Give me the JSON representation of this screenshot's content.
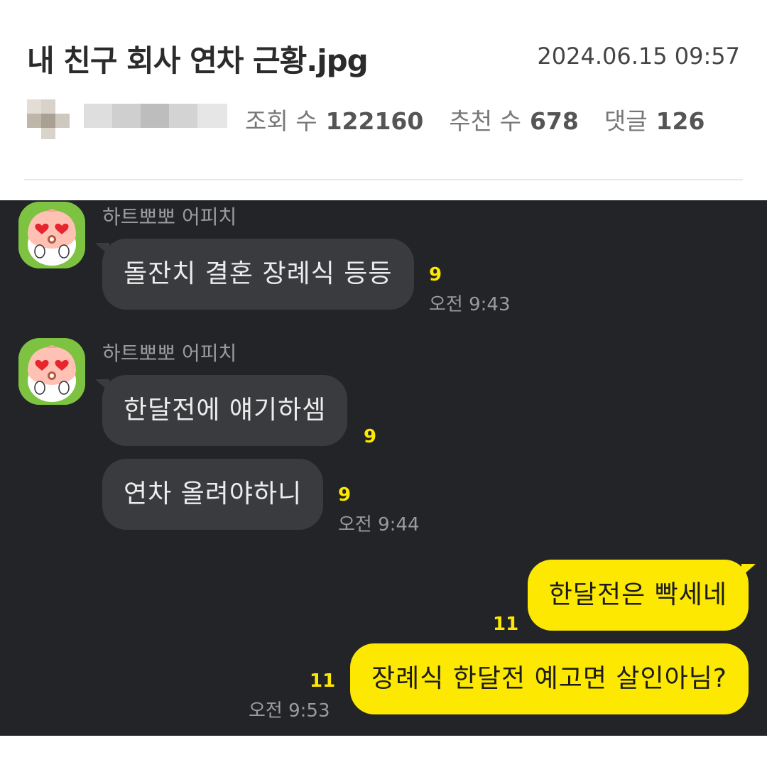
{
  "post": {
    "title": "내 친구 회사 연차 근황.jpg",
    "date": "2024.06.15 09:57",
    "stats": {
      "views_label": "조회 수",
      "views": "122160",
      "likes_label": "추천 수",
      "likes": "678",
      "comments_label": "댓글",
      "comments": "126"
    }
  },
  "chat": {
    "messages": [
      {
        "sender": "하트뽀뽀 어피치",
        "text": "돌잔치 결혼 장례식 등등",
        "unread": "9",
        "time": "오전 9:43"
      },
      {
        "sender": "하트뽀뽀 어피치",
        "text": "한달전에 얘기하셈",
        "unread": "9"
      },
      {
        "text": "연차 올려야하니",
        "unread": "9",
        "time": "오전 9:44"
      },
      {
        "text": "한달전은 빡세네",
        "unread": "11"
      },
      {
        "text": "장례식 한달전 예고면 살인아님?",
        "unread": "11",
        "time": "오전 9:53"
      }
    ]
  },
  "icons": {
    "avatar": "apeach-heart-eyes-icon"
  },
  "colors": {
    "chat_background": "#232427",
    "my_bubble": "#fce800",
    "their_bubble": "#3a3b3f",
    "unread_count": "#fce800"
  }
}
